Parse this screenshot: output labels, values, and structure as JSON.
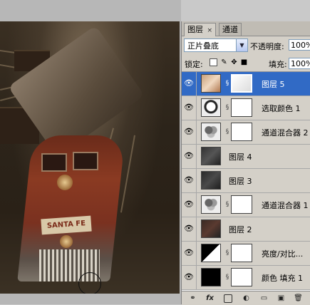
{
  "panel": {
    "tabs": [
      {
        "label": "图层",
        "close": "×",
        "active": true
      },
      {
        "label": "通道",
        "active": false
      }
    ],
    "blend_mode": "正片叠底",
    "opacity_label": "不透明度:",
    "opacity_value": "100%",
    "lock_label": "锁定:",
    "fill_label": "填充:",
    "fill_value": "100%",
    "layers": [
      {
        "name": "图层 5",
        "selected": true,
        "has_mask": true,
        "thumb": "photo-warm"
      },
      {
        "name": "选取颜色 1",
        "selected": false,
        "has_mask": true,
        "thumb": "selective-color-adjustment"
      },
      {
        "name": "通道混合器 2",
        "selected": false,
        "has_mask": true,
        "thumb": "channel-mixer-adjustment"
      },
      {
        "name": "图层 4",
        "selected": false,
        "has_mask": false,
        "thumb": "photo-dark"
      },
      {
        "name": "图层 3",
        "selected": false,
        "has_mask": false,
        "thumb": "photo-dark"
      },
      {
        "name": "通道混合器 1",
        "selected": false,
        "has_mask": true,
        "thumb": "channel-mixer-adjustment"
      },
      {
        "name": "图层 2",
        "selected": false,
        "has_mask": false,
        "thumb": "photo-dark"
      },
      {
        "name": "亮度/对比...",
        "selected": false,
        "has_mask": true,
        "thumb": "brightness-contrast-adjustment"
      },
      {
        "name": "颜色 填充 1",
        "selected": false,
        "has_mask": true,
        "thumb": "solid-black"
      }
    ],
    "bottom_icons": [
      "link-icon",
      "fx-icon",
      "add-mask-icon",
      "adjustment-layer-icon",
      "group-folder-icon",
      "new-layer-icon",
      "trash-icon"
    ],
    "fx_label": "fx"
  },
  "canvas": {
    "logo_text": "SANTA FE"
  },
  "colors": {
    "selection": "#316ac5",
    "panel_bg": "#d4d0c8"
  }
}
